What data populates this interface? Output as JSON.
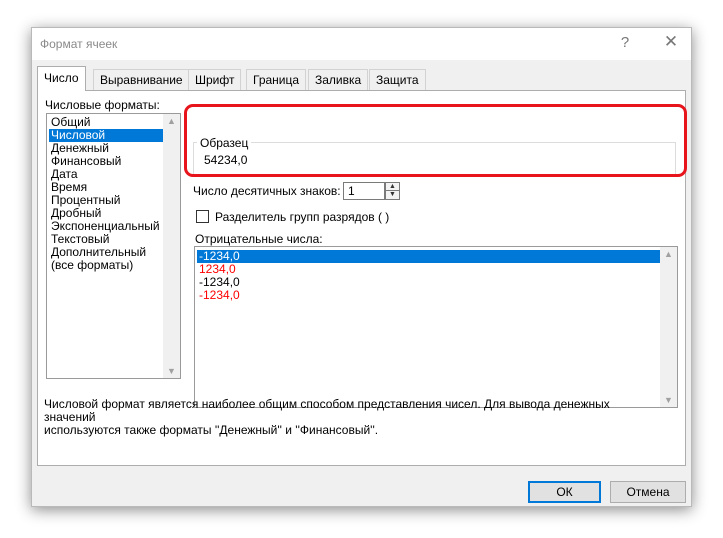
{
  "dialog": {
    "title": "Формат ячеек",
    "help_glyph": "?",
    "close_glyph": "✕"
  },
  "tabs": [
    {
      "label": "Число",
      "active": true
    },
    {
      "label": "Выравнивание",
      "active": false
    },
    {
      "label": "Шрифт",
      "active": false
    },
    {
      "label": "Граница",
      "active": false
    },
    {
      "label": "Заливка",
      "active": false
    },
    {
      "label": "Защита",
      "active": false
    }
  ],
  "formats": {
    "label": "Числовые форматы:",
    "items": [
      "Общий",
      "Числовой",
      "Денежный",
      "Финансовый",
      "Дата",
      "Время",
      "Процентный",
      "Дробный",
      "Экспоненциальный",
      "Текстовый",
      "Дополнительный",
      "(все форматы)"
    ],
    "selected": "Числовой"
  },
  "sample": {
    "legend": "Образец",
    "value": "54234,0"
  },
  "decimals": {
    "label": "Число десятичных знаков:",
    "value": "1"
  },
  "separator": {
    "label": "Разделитель групп разрядов ( )",
    "checked": false
  },
  "negative": {
    "label": "Отрицательные числа:",
    "items": [
      {
        "text": "-1234,0",
        "color": "#000000",
        "selected": true
      },
      {
        "text": "1234,0",
        "color": "#ff0000",
        "selected": false
      },
      {
        "text": "-1234,0",
        "color": "#000000",
        "selected": false
      },
      {
        "text": "-1234,0",
        "color": "#ff0000",
        "selected": false
      }
    ]
  },
  "description": {
    "line1": "Числовой формат является наиболее общим способом представления чисел. Для вывода денежных значений",
    "line2": "используются также форматы ''Денежный'' и ''Финансовый''."
  },
  "buttons": {
    "ok": "ОК",
    "cancel": "Отмена"
  },
  "colors": {
    "accent": "#0078d7",
    "highlight": "#e8141c",
    "negative_red": "#ff0000"
  }
}
